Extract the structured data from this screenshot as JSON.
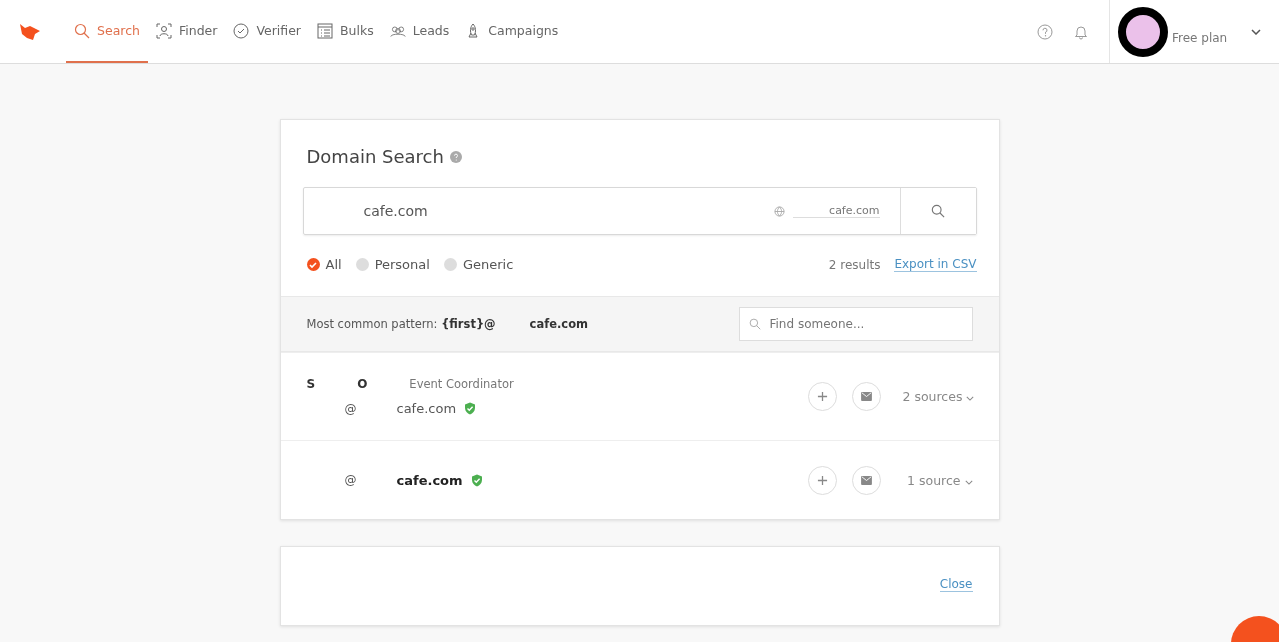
{
  "nav": {
    "items": [
      {
        "label": "Search",
        "selected": true
      },
      {
        "label": "Finder",
        "selected": false
      },
      {
        "label": "Verifier",
        "selected": false
      },
      {
        "label": "Bulks",
        "selected": false
      },
      {
        "label": "Leads",
        "selected": false
      },
      {
        "label": "Campaigns",
        "selected": false
      }
    ],
    "account": {
      "plan": "Free plan"
    }
  },
  "domain_search": {
    "title": "Domain Search",
    "query": "cafe.com",
    "domain": "cafe.com",
    "filters": [
      {
        "label": "All",
        "selected": true
      },
      {
        "label": "Personal",
        "selected": false
      },
      {
        "label": "Generic",
        "selected": false
      }
    ],
    "results_count": "2 results",
    "export_link": "Export in CSV",
    "pattern_label": "Most common pattern:",
    "pattern": "{first}@",
    "pattern_domain": "cafe.com",
    "find_placeholder": "Find someone...",
    "results": [
      {
        "first_name": "S",
        "last_name": "O",
        "position": "Event Coordinator",
        "at": "@",
        "domain": "cafe.com",
        "verified": true,
        "sources": "2 sources"
      },
      {
        "at": "@",
        "domain": "cafe.com",
        "verified": true,
        "sources": "1 source"
      }
    ]
  },
  "second_card": {
    "close_link": "Close"
  }
}
